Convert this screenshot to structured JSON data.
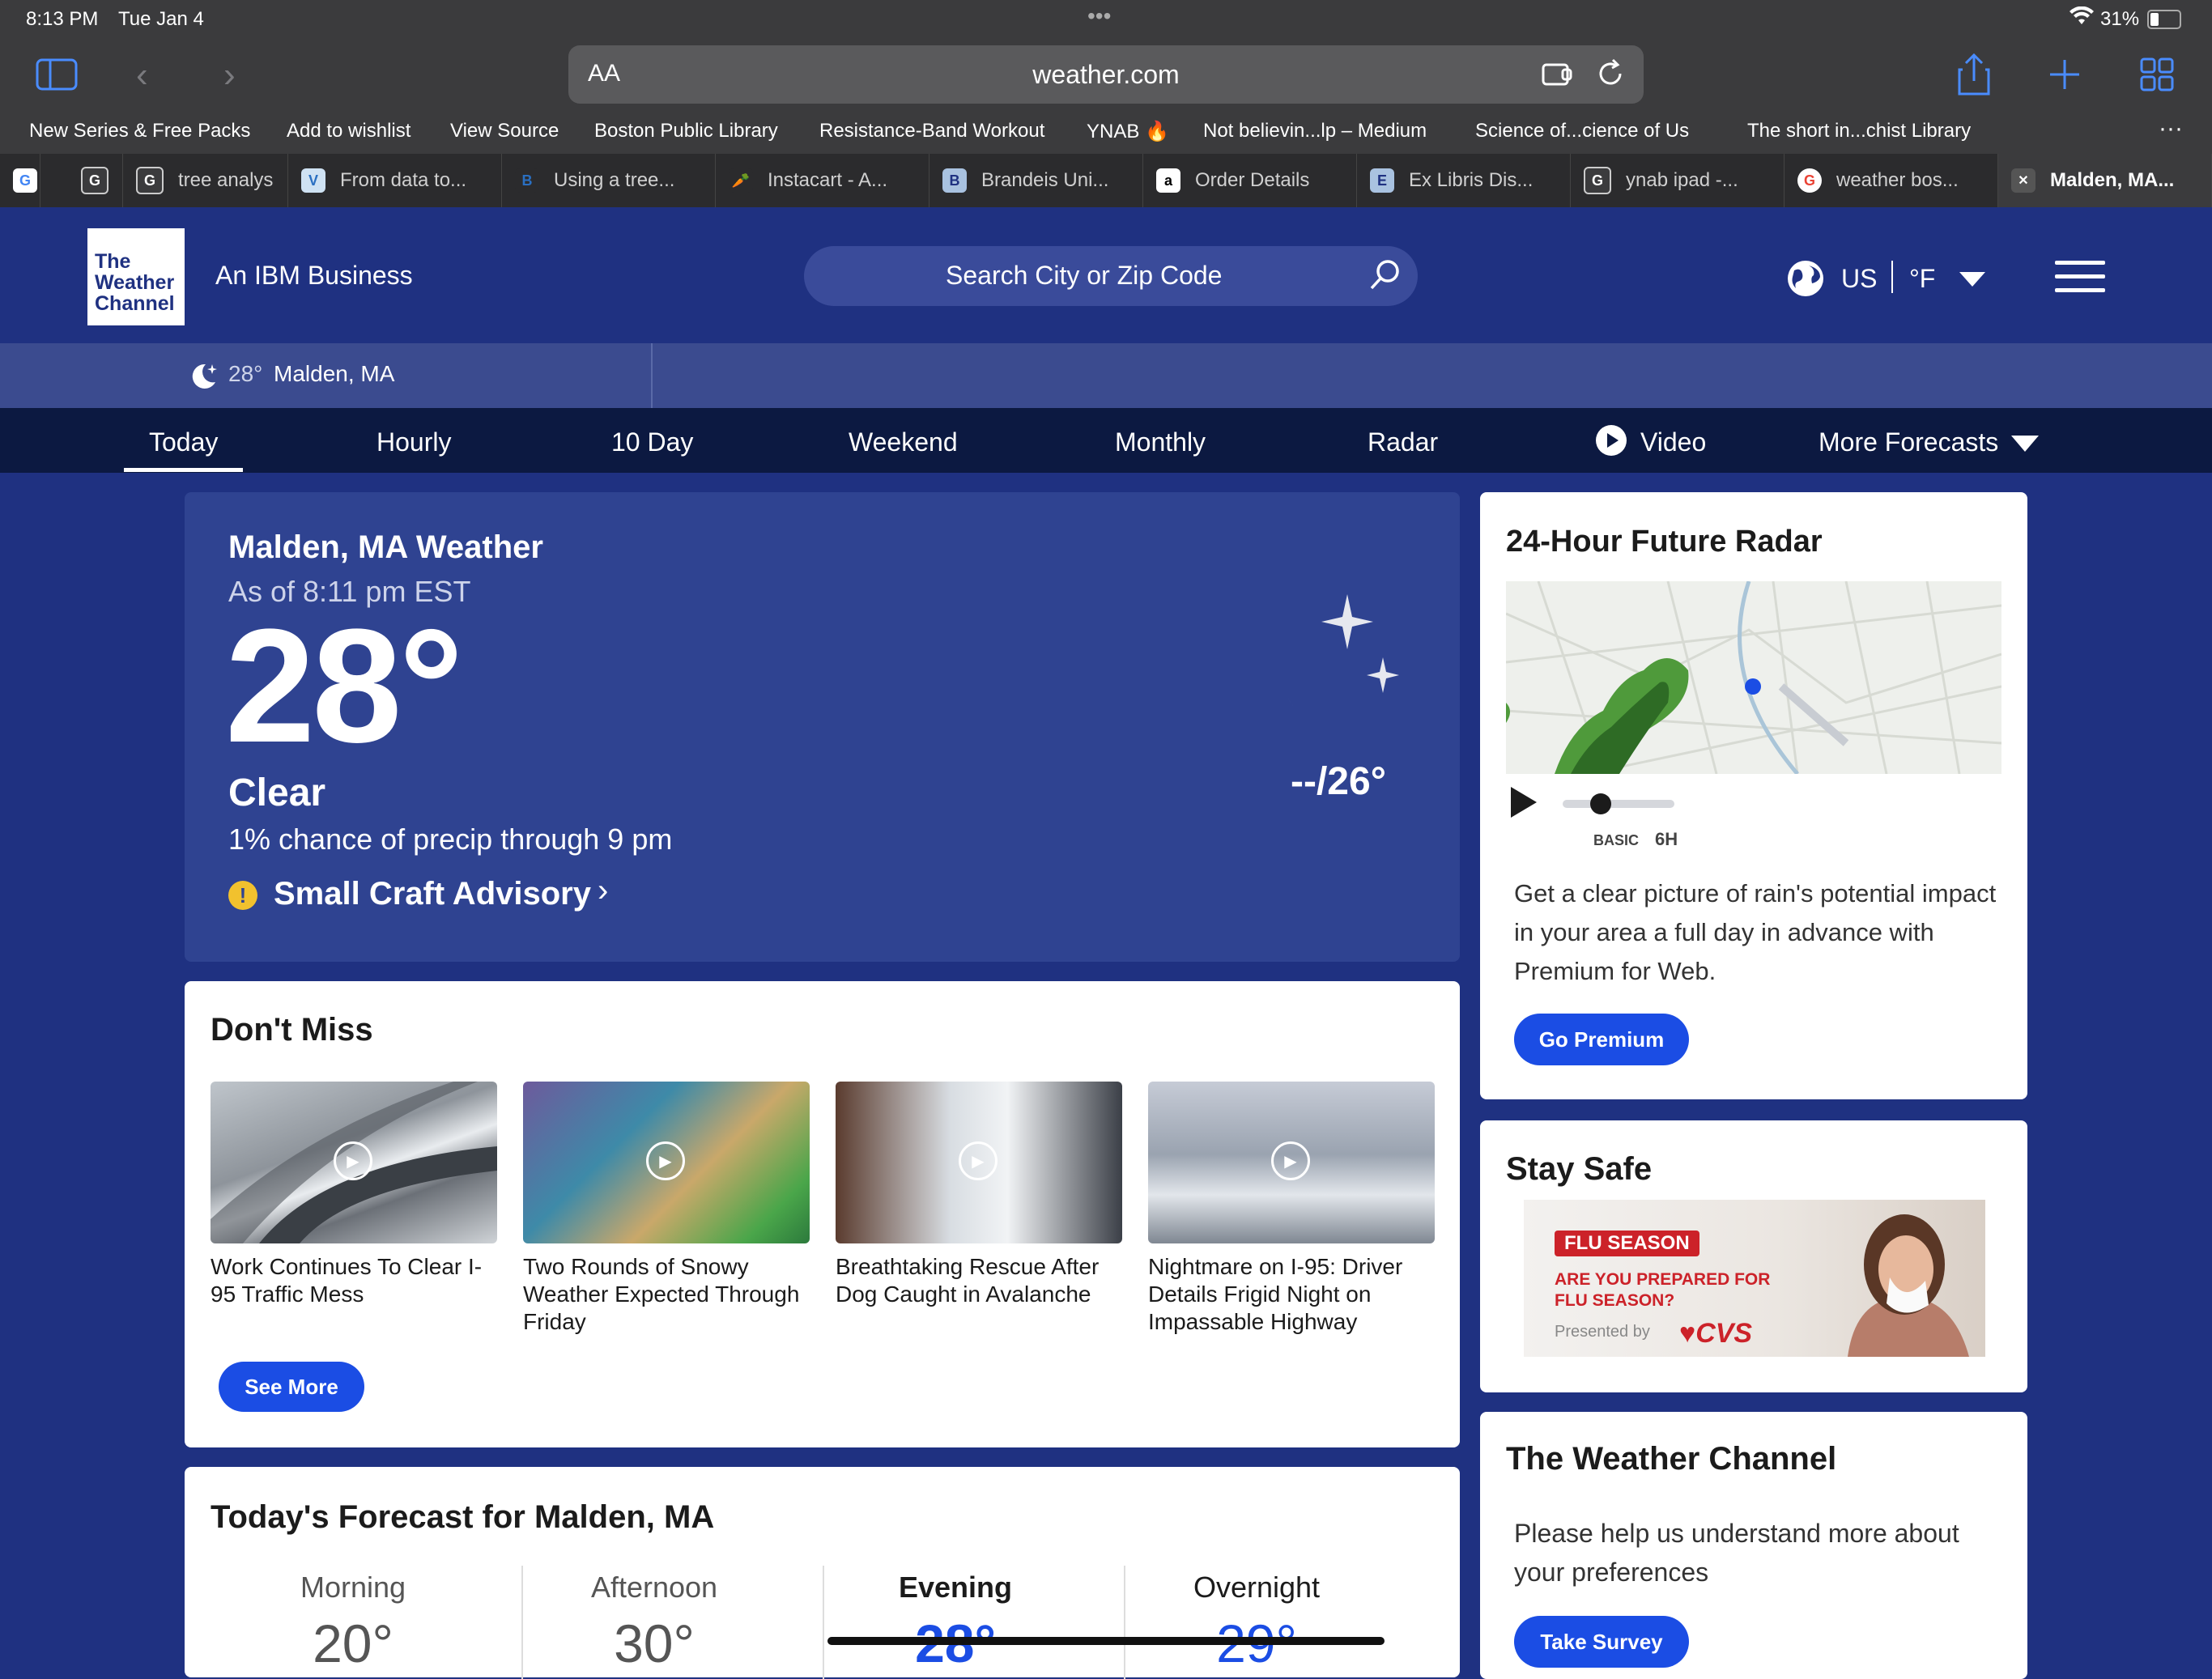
{
  "status": {
    "time": "8:13 PM",
    "date": "Tue Jan 4",
    "battery": "31%"
  },
  "browser": {
    "url_prefix": "AA",
    "url": "weather.com",
    "bookmarks": [
      "New Series & Free Packs",
      "Add to wishlist",
      "View Source",
      "Boston Public Library",
      "Resistance-Band Workout",
      "YNAB 🔥",
      "Not believin...lp – Medium",
      "Science of...cience of Us",
      "The short in...chist Library"
    ],
    "bookmarks_more": "···",
    "tabs": [
      {
        "label": "",
        "icon": "G"
      },
      {
        "label": "",
        "icon": "G"
      },
      {
        "label": "tree analys",
        "icon": "G"
      },
      {
        "label": "From data to...",
        "icon": "V"
      },
      {
        "label": "Using a tree...",
        "icon": "B"
      },
      {
        "label": "Instacart - A...",
        "icon": "🥕"
      },
      {
        "label": "Brandeis Uni...",
        "icon": "B"
      },
      {
        "label": "Order Details",
        "icon": "a"
      },
      {
        "label": "Ex Libris Dis...",
        "icon": "E"
      },
      {
        "label": "ynab ipad -...",
        "icon": "G"
      },
      {
        "label": "weather bos...",
        "icon": "G"
      },
      {
        "label": "Malden, MA...",
        "icon": "✕"
      }
    ]
  },
  "header": {
    "logo_lines": [
      "The",
      "Weather",
      "Channel"
    ],
    "tagline": "An IBM Business",
    "search_placeholder": "Search City or Zip Code",
    "region": "US",
    "unit": "°F"
  },
  "location_strip": {
    "temp": "28°",
    "place": "Malden, MA"
  },
  "nav": [
    "Today",
    "Hourly",
    "10 Day",
    "Weekend",
    "Monthly",
    "Radar",
    "Video",
    "More Forecasts"
  ],
  "current": {
    "title": "Malden, MA Weather",
    "as_of": "As of 8:11 pm EST",
    "temp": "28°",
    "condition": "Clear",
    "precip": "1% chance of precip through 9 pm",
    "advisory": "Small Craft Advisory",
    "hilo": "--/26°"
  },
  "dont_miss": {
    "title": "Don't Miss",
    "items": [
      {
        "title": "Work Continues To Clear I-95 Traffic Mess"
      },
      {
        "title": "Two Rounds of Snowy Weather Expected Through Friday"
      },
      {
        "title": "Breathtaking Rescue After Dog Caught in Avalanche"
      },
      {
        "title": "Nightmare on I-95: Driver Details Frigid Night on Impassable Highway"
      }
    ],
    "see_more": "See More"
  },
  "todays_forecast": {
    "title": "Today's Forecast for Malden, MA",
    "periods": [
      {
        "label": "Morning",
        "temp": "20°"
      },
      {
        "label": "Afternoon",
        "temp": "30°"
      },
      {
        "label": "Evening",
        "temp": "28°"
      },
      {
        "label": "Overnight",
        "temp": "29°"
      }
    ]
  },
  "radar": {
    "title": "24-Hour Future Radar",
    "slider_basic": "BASIC",
    "slider_6h": "6H",
    "desc": "Get a clear picture of rain's potential impact in your area a full day in advance with Premium for Web.",
    "cta": "Go Premium"
  },
  "stay_safe": {
    "title": "Stay Safe",
    "ad_badge": "FLU SEASON",
    "ad_question": "ARE YOU PREPARED FOR FLU SEASON?",
    "ad_presented": "Presented by",
    "ad_brand": "CVS"
  },
  "survey": {
    "title": "The Weather Channel",
    "desc": "Please help us understand more about your preferences",
    "cta": "Take Survey"
  },
  "colors": {
    "brand_blue": "#1f3181",
    "accent_button": "#1b4de4",
    "nav_dark": "#0c1941",
    "card_blue": "#2f4391"
  }
}
